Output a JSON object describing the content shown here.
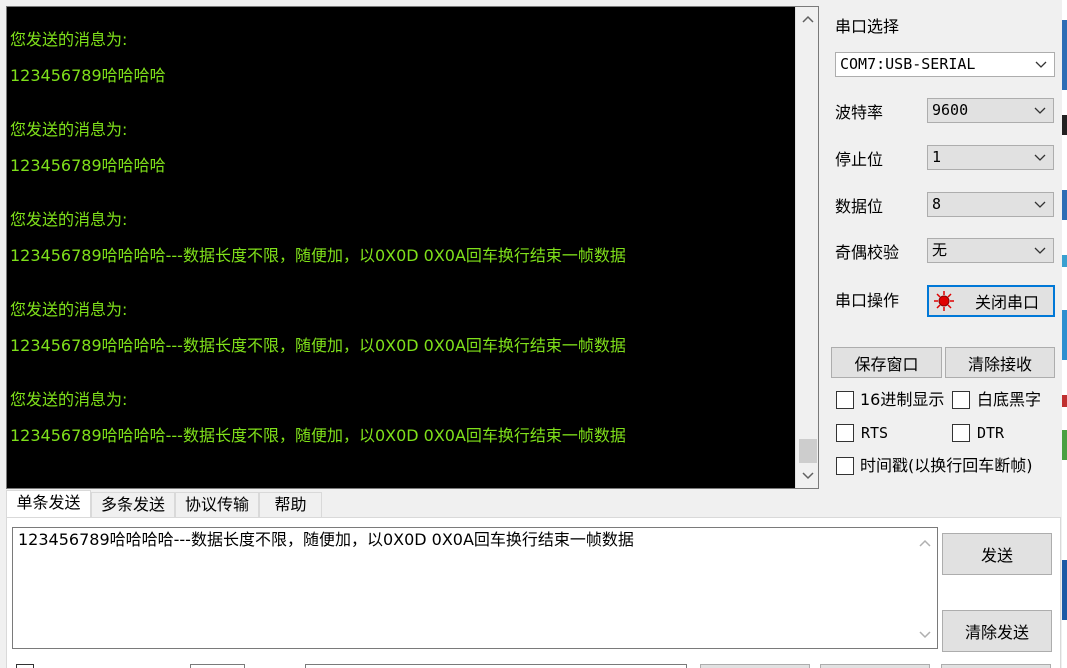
{
  "receive": {
    "lines": [
      "您发送的消息为:",
      "123456789哈哈哈哈",
      "您发送的消息为:",
      "123456789哈哈哈哈",
      "您发送的消息为:",
      "123456789哈哈哈哈---数据长度不限，随便加，以0X0D 0X0A回车换行结束一帧数据",
      "您发送的消息为:",
      "123456789哈哈哈哈---数据长度不限，随便加，以0X0D 0X0A回车换行结束一帧数据",
      "您发送的消息为:",
      "123456789哈哈哈哈---数据长度不限，随便加，以0X0D 0X0A回车换行结束一帧数据"
    ]
  },
  "serial": {
    "port_label": "串口选择",
    "port_value": "COM7:USB-SERIAL",
    "baud_label": "波特率",
    "baud_value": "9600",
    "stop_label": "停止位",
    "stop_value": "1",
    "data_label": "数据位",
    "data_value": "8",
    "parity_label": "奇偶校验",
    "parity_value": "无",
    "op_label": "串口操作",
    "op_button": "关闭串口"
  },
  "actions": {
    "save_window": "保存窗口",
    "clear_receive": "清除接收"
  },
  "options": {
    "hex_display": "16进制显示",
    "white_bg": "白底黑字",
    "rts": "RTS",
    "dtr": "DTR",
    "timestamp": "时间戳(以换行回车断帧)"
  },
  "tabs": [
    "单条发送",
    "多条发送",
    "协议传输",
    "帮助"
  ],
  "send": {
    "text": "123456789哈哈哈哈---数据长度不限，随便加，以0X0D 0X0A回车换行结束一帧数据",
    "send_button": "发送",
    "clear_button": "清除发送"
  },
  "colors": {
    "receive_bg": "#000000",
    "receive_text": "#7fe01a",
    "focus_border": "#0078d7",
    "indicator": "#e00000"
  }
}
